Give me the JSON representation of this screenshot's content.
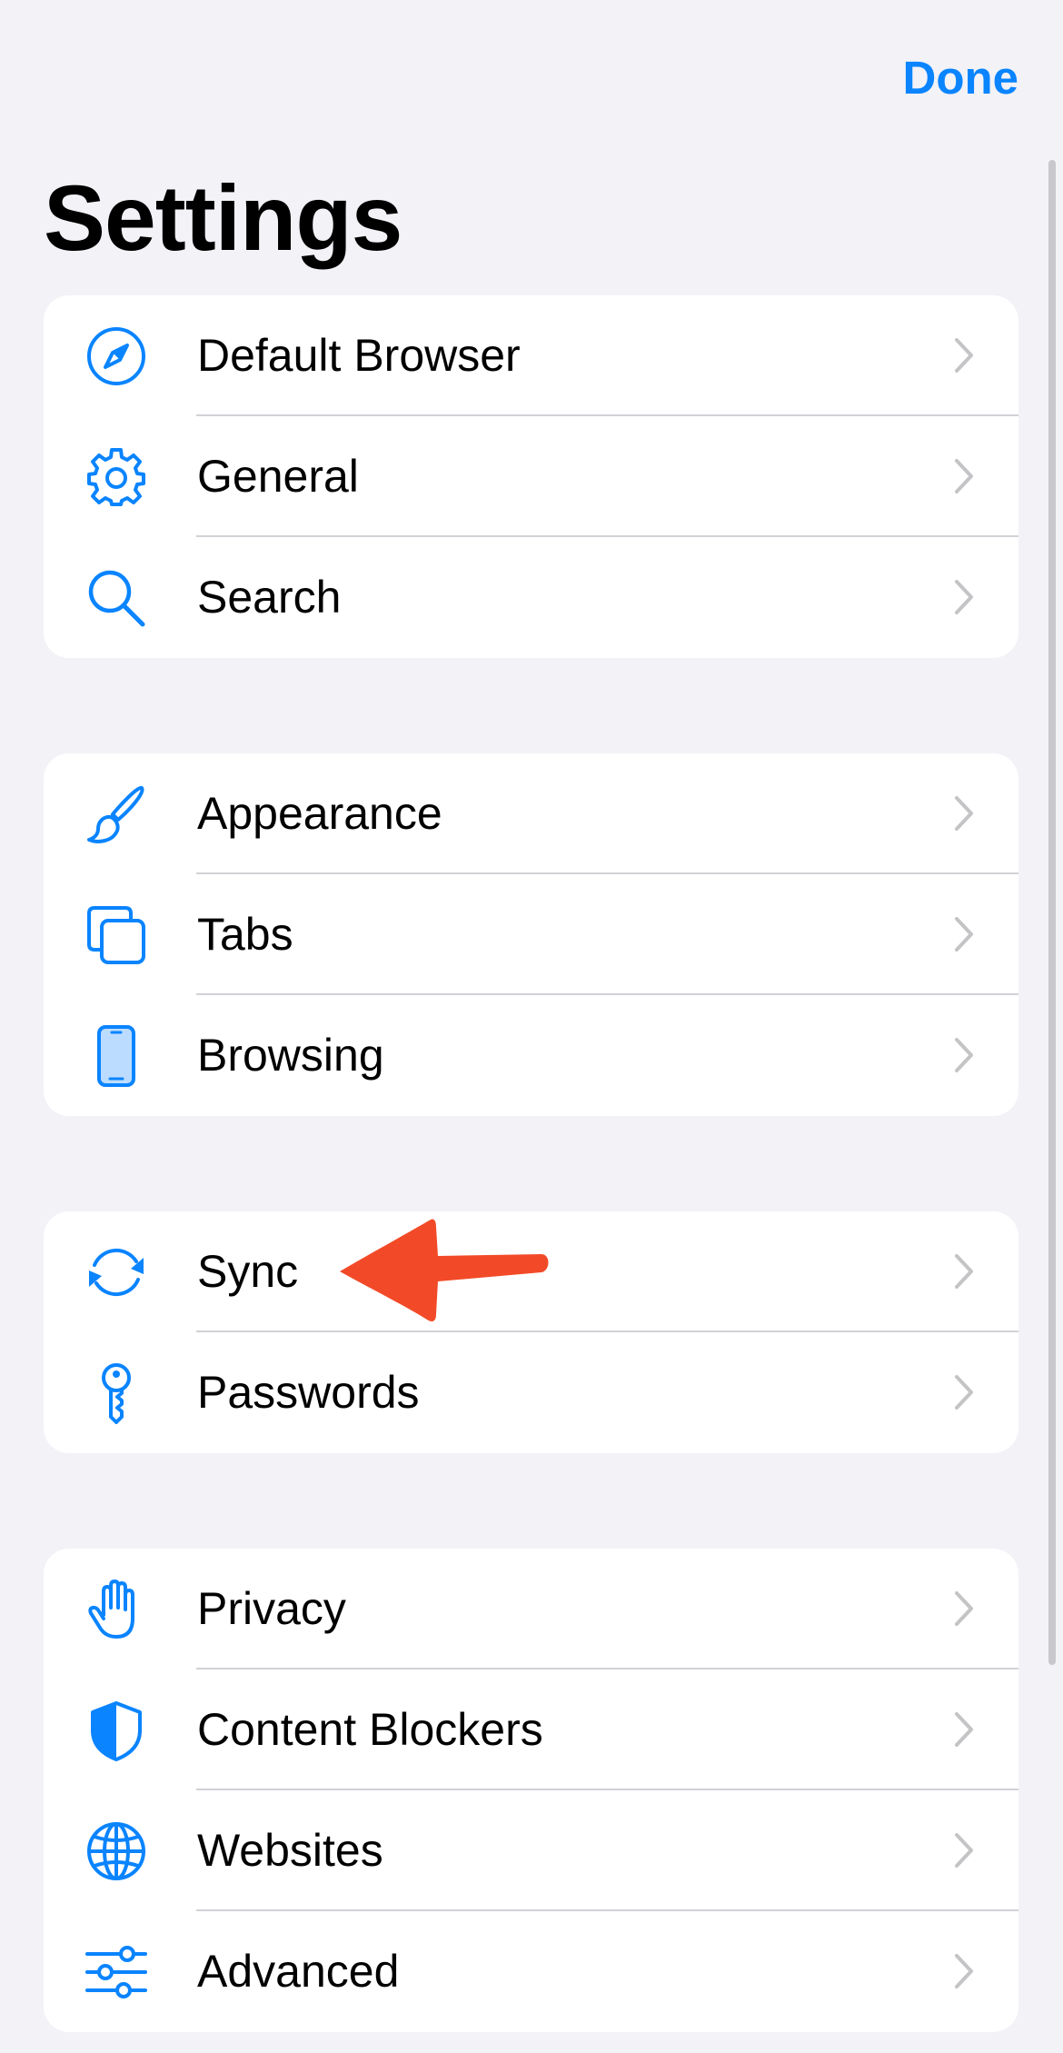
{
  "header": {
    "done_label": "Done",
    "title": "Settings"
  },
  "colors": {
    "accent": "#0a84ff",
    "annotation_arrow": "#f24a28"
  },
  "groups": [
    {
      "items": [
        {
          "label": "Default Browser",
          "icon": "compass-icon"
        },
        {
          "label": "General",
          "icon": "gear-icon"
        },
        {
          "label": "Search",
          "icon": "search-icon"
        }
      ]
    },
    {
      "items": [
        {
          "label": "Appearance",
          "icon": "paintbrush-icon"
        },
        {
          "label": "Tabs",
          "icon": "tabs-icon"
        },
        {
          "label": "Browsing",
          "icon": "phone-icon"
        }
      ]
    },
    {
      "items": [
        {
          "label": "Sync",
          "icon": "sync-icon"
        },
        {
          "label": "Passwords",
          "icon": "key-icon"
        }
      ]
    },
    {
      "items": [
        {
          "label": "Privacy",
          "icon": "hand-icon"
        },
        {
          "label": "Content Blockers",
          "icon": "shield-icon"
        },
        {
          "label": "Websites",
          "icon": "globe-icon"
        },
        {
          "label": "Advanced",
          "icon": "sliders-icon"
        }
      ]
    }
  ]
}
